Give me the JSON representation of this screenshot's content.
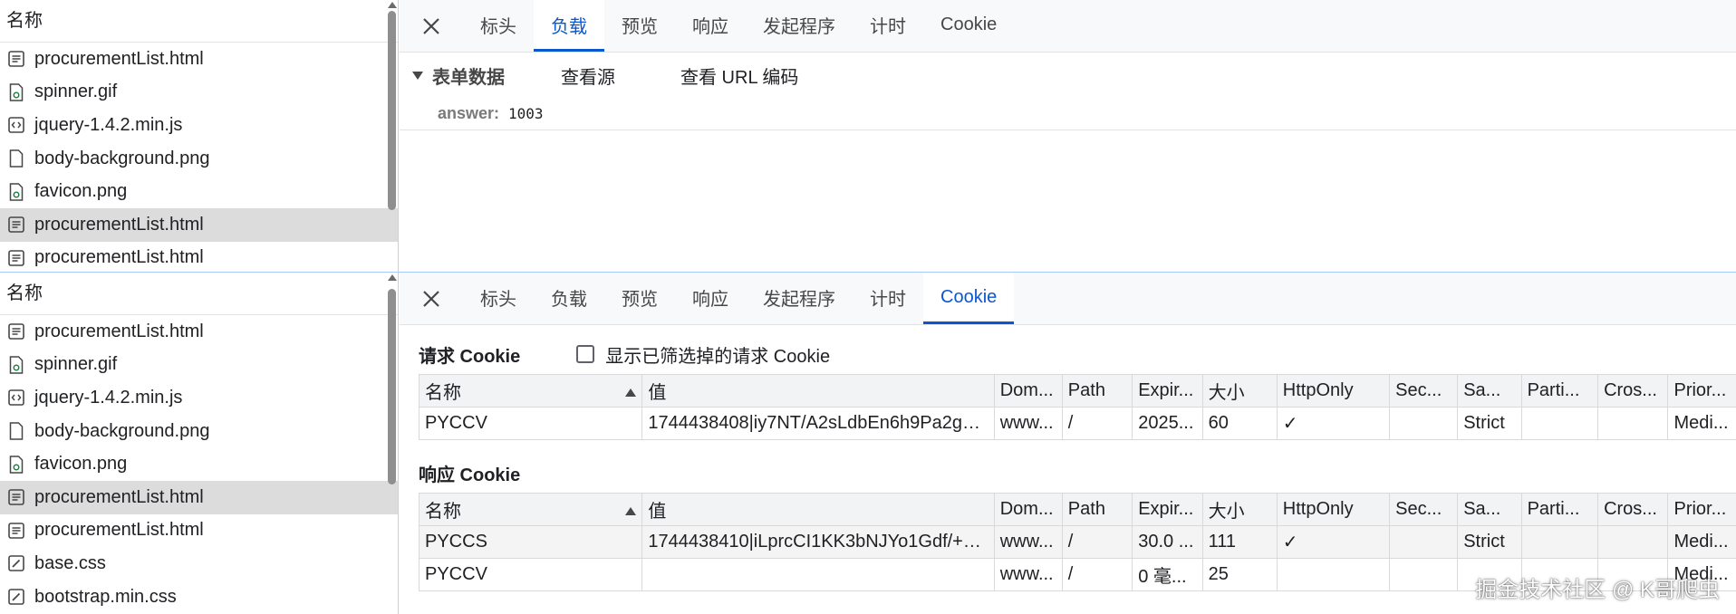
{
  "list_header": "名称",
  "top_list": [
    {
      "name": "procurementList.html",
      "icon": "document-icon",
      "selected": false
    },
    {
      "name": "spinner.gif",
      "icon": "image-file-icon",
      "selected": false
    },
    {
      "name": "jquery-1.4.2.min.js",
      "icon": "script-icon",
      "selected": false
    },
    {
      "name": "body-background.png",
      "icon": "file-icon",
      "selected": false
    },
    {
      "name": "favicon.png",
      "icon": "image-file-icon",
      "selected": false
    },
    {
      "name": "procurementList.html",
      "icon": "document-icon",
      "selected": true
    },
    {
      "name": "procurementList.html",
      "icon": "document-icon",
      "selected": false
    }
  ],
  "bottom_list": [
    {
      "name": "procurementList.html",
      "icon": "document-icon",
      "selected": false
    },
    {
      "name": "spinner.gif",
      "icon": "image-file-icon",
      "selected": false
    },
    {
      "name": "jquery-1.4.2.min.js",
      "icon": "script-icon",
      "selected": false
    },
    {
      "name": "body-background.png",
      "icon": "file-icon",
      "selected": false
    },
    {
      "name": "favicon.png",
      "icon": "image-file-icon",
      "selected": false
    },
    {
      "name": "procurementList.html",
      "icon": "document-icon",
      "selected": true
    },
    {
      "name": "procurementList.html",
      "icon": "document-icon",
      "selected": false
    },
    {
      "name": "base.css",
      "icon": "stylesheet-icon",
      "selected": false
    },
    {
      "name": "bootstrap.min.css",
      "icon": "stylesheet-icon",
      "selected": false
    }
  ],
  "tabs": [
    "标头",
    "负载",
    "预览",
    "响应",
    "发起程序",
    "计时",
    "Cookie"
  ],
  "top_active_tab": 1,
  "bottom_active_tab": 6,
  "payload": {
    "section_title": "表单数据",
    "view_source": "查看源",
    "view_url_encoded": "查看 URL 编码",
    "key": "answer:",
    "value": "1003"
  },
  "cookies": {
    "request_title": "请求 Cookie",
    "show_filtered_label": "显示已筛选掉的请求 Cookie",
    "response_title": "响应 Cookie",
    "columns": [
      "名称",
      "值",
      "Dom...",
      "Path",
      "Expir...",
      "大小",
      "HttpOnly",
      "Sec...",
      "Sa...",
      "Parti...",
      "Cros...",
      "Prior..."
    ],
    "request_rows": [
      [
        "PYCCV",
        "1744438408|iy7NT/A2sLdbEn6h9Pa2gC...",
        "www...",
        "/",
        "2025...",
        "60",
        "✓",
        "",
        "Strict",
        "",
        "",
        "Medi..."
      ]
    ],
    "response_rows": [
      [
        "PYCCS",
        "1744438410|iLprcCI1KK3bNJYo1Gdf/+U...",
        "www...",
        "/",
        "30.0 ...",
        "111",
        "✓",
        "",
        "Strict",
        "",
        "",
        "Medi..."
      ],
      [
        "PYCCV",
        "",
        "www...",
        "/",
        "0 毫...",
        "25",
        "",
        "",
        "",
        "",
        "",
        "Medi..."
      ]
    ]
  },
  "watermark": "掘金技术社区 @ K哥爬虫",
  "colors": {
    "accent": "#0b57d0",
    "selected_row": "#dcdcdc"
  }
}
